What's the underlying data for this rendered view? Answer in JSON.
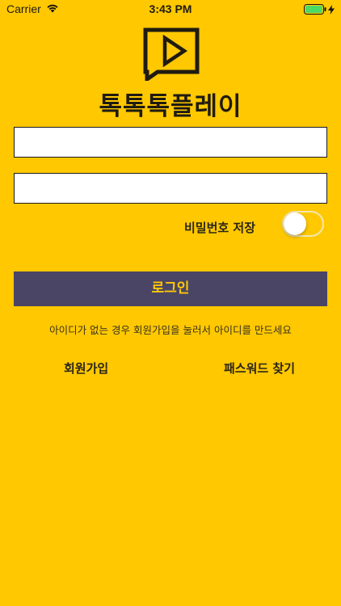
{
  "status_bar": {
    "carrier": "Carrier",
    "time": "3:43 PM",
    "icons": [
      "wifi-icon",
      "battery-icon",
      "charging-bolt-icon"
    ]
  },
  "app": {
    "title": "톡톡톡플레이",
    "logo_icon": "play-speech-bubble-icon"
  },
  "form": {
    "id_field": {
      "value": "",
      "placeholder": ""
    },
    "password_field": {
      "value": "",
      "placeholder": ""
    },
    "save_password_label": "비밀번호 저장",
    "save_password_on": false,
    "login_label": "로그인",
    "hint": "아이디가 없는 경우 회원가입을 눌러서 아이디를 만드세요",
    "signup_label": "회원가입",
    "find_password_label": "패스워드 찾기"
  },
  "colors": {
    "background": "#FFC800",
    "button": "#4A4565",
    "button_text": "#FFC800",
    "battery": "#4CD964"
  }
}
